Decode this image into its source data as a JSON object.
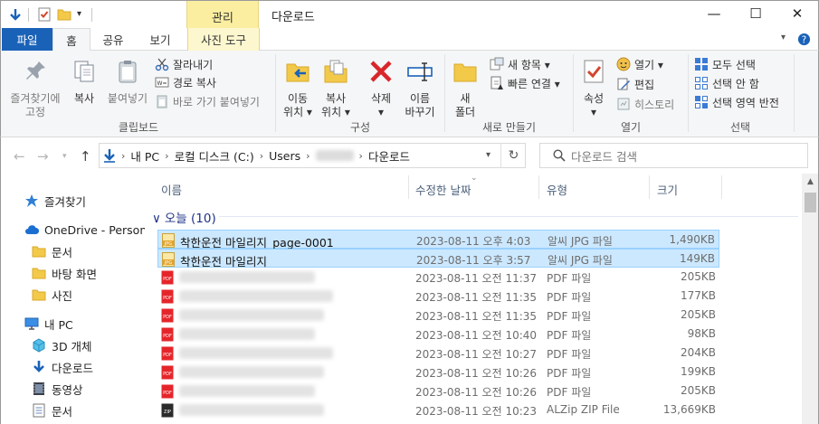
{
  "window": {
    "context_tab": "관리",
    "title": "다운로드",
    "minimize": "—",
    "maximize": "☐",
    "close": "✕"
  },
  "ribbon_tabs": [
    "파일",
    "홈",
    "공유",
    "보기",
    "사진 도구"
  ],
  "ribbon": {
    "clipboard": {
      "pin_label": "즐겨찾기에\n고정",
      "copy_label": "복사",
      "paste_label": "붙여넣기",
      "cut_label": "잘라내기",
      "copy_path_label": "경로 복사",
      "paste_shortcut_label": "바로 가기 붙여넣기",
      "group_label": "클립보드"
    },
    "organize": {
      "move_label": "이동\n위치 ▾",
      "copyto_label": "복사\n위치 ▾",
      "delete_label": "삭제\n▾",
      "rename_label": "이름\n바꾸기",
      "group_label": "구성"
    },
    "new": {
      "new_folder_label": "새\n폴더",
      "new_item_label": "새 항목 ▾",
      "easy_access_label": "빠른 연결 ▾",
      "group_label": "새로 만들기"
    },
    "open": {
      "properties_label": "속성\n▾",
      "open_label": "열기 ▾",
      "edit_label": "편집",
      "history_label": "히스토리",
      "group_label": "열기"
    },
    "select": {
      "select_all_label": "모두 선택",
      "select_none_label": "선택 안 함",
      "invert_label": "선택 영역 반전",
      "group_label": "선택"
    }
  },
  "address": {
    "crumbs": [
      "내 PC",
      "로컬 디스크 (C:)",
      "Users",
      "다운로드"
    ],
    "search_placeholder": "다운로드 검색"
  },
  "nav_pane": {
    "items": [
      "즐겨찾기",
      "OneDrive - Personal",
      "문서",
      "바탕 화면",
      "사진",
      "내 PC",
      "3D 개체",
      "다운로드",
      "동영상",
      "문서"
    ]
  },
  "file_list": {
    "columns": [
      "이름",
      "수정한 날짜",
      "유형",
      "크기"
    ],
    "group_header": "오늘 (10)",
    "rows": [
      {
        "name": "착한운전 마일리지_page-0001",
        "date": "2023-08-11 오후 4:03",
        "type": "알씨 JPG 파일",
        "size": "1,490KB",
        "selected": true,
        "kind": "jpg"
      },
      {
        "name": "착한운전 마일리지",
        "date": "2023-08-11 오후 3:57",
        "type": "알씨 JPG 파일",
        "size": "149KB",
        "selected": true,
        "kind": "jpg"
      },
      {
        "name": "",
        "date": "2023-08-11 오전 11:37",
        "type": "PDF 파일",
        "size": "205KB",
        "selected": false,
        "kind": "pdf"
      },
      {
        "name": "",
        "date": "2023-08-11 오전 11:35",
        "type": "PDF 파일",
        "size": "177KB",
        "selected": false,
        "kind": "pdf"
      },
      {
        "name": "",
        "date": "2023-08-11 오전 11:35",
        "type": "PDF 파일",
        "size": "205KB",
        "selected": false,
        "kind": "pdf"
      },
      {
        "name": "",
        "date": "2023-08-11 오전 10:40",
        "type": "PDF 파일",
        "size": "98KB",
        "selected": false,
        "kind": "pdf"
      },
      {
        "name": "",
        "date": "2023-08-11 오전 10:27",
        "type": "PDF 파일",
        "size": "204KB",
        "selected": false,
        "kind": "pdf"
      },
      {
        "name": "",
        "date": "2023-08-11 오전 10:26",
        "type": "PDF 파일",
        "size": "199KB",
        "selected": false,
        "kind": "pdf"
      },
      {
        "name": "",
        "date": "2023-08-11 오전 10:26",
        "type": "PDF 파일",
        "size": "205KB",
        "selected": false,
        "kind": "pdf"
      },
      {
        "name": "",
        "date": "2023-08-11 오전 10:23",
        "type": "ALZip ZIP File",
        "size": "13,669KB",
        "selected": false,
        "kind": "zip"
      }
    ]
  },
  "colors": {
    "file_tab": "#1a62b8",
    "context_tab": "#fbeea0",
    "selection": "#cce8ff",
    "group_header": "#1e3287"
  }
}
